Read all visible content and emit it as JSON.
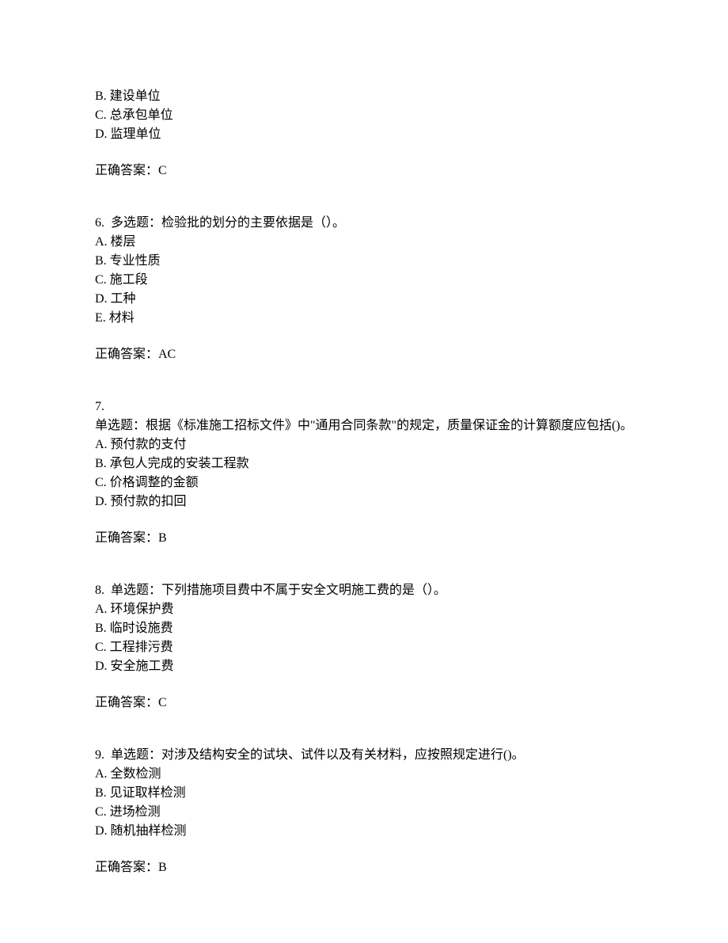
{
  "q5": {
    "options": {
      "B": "B. 建设单位",
      "C": "C. 总承包单位",
      "D": "D. 监理单位"
    },
    "answerLabel": "正确答案：C"
  },
  "q6": {
    "prompt": "6.  多选题：检验批的划分的主要依据是（）。",
    "options": {
      "A": "A. 楼层",
      "B": "B. 专业性质",
      "C": "C. 施工段",
      "D": "D. 工种",
      "E": "E. 材料"
    },
    "answerLabel": "正确答案：AC"
  },
  "q7": {
    "number": "7.",
    "prompt": "单选题：根据《标准施工招标文件》中\"通用合同条款\"的规定，质量保证金的计算额度应包括()。",
    "options": {
      "A": "A. 预付款的支付",
      "B": "B. 承包人完成的安装工程款",
      "C": "C. 价格调整的金额",
      "D": "D. 预付款的扣回"
    },
    "answerLabel": "正确答案：B"
  },
  "q8": {
    "prompt": "8.  单选题：下列措施项目费中不属于安全文明施工费的是（）。",
    "options": {
      "A": "A. 环境保护费",
      "B": "B. 临时设施费",
      "C": "C. 工程排污费",
      "D": "D. 安全施工费"
    },
    "answerLabel": "正确答案：C"
  },
  "q9": {
    "prompt": "9.  单选题：对涉及结构安全的试块、试件以及有关材料，应按照规定进行()。",
    "options": {
      "A": "A. 全数检测",
      "B": "B. 见证取样检测",
      "C": "C. 进场检测",
      "D": "D. 随机抽样检测"
    },
    "answerLabel": "正确答案：B"
  }
}
